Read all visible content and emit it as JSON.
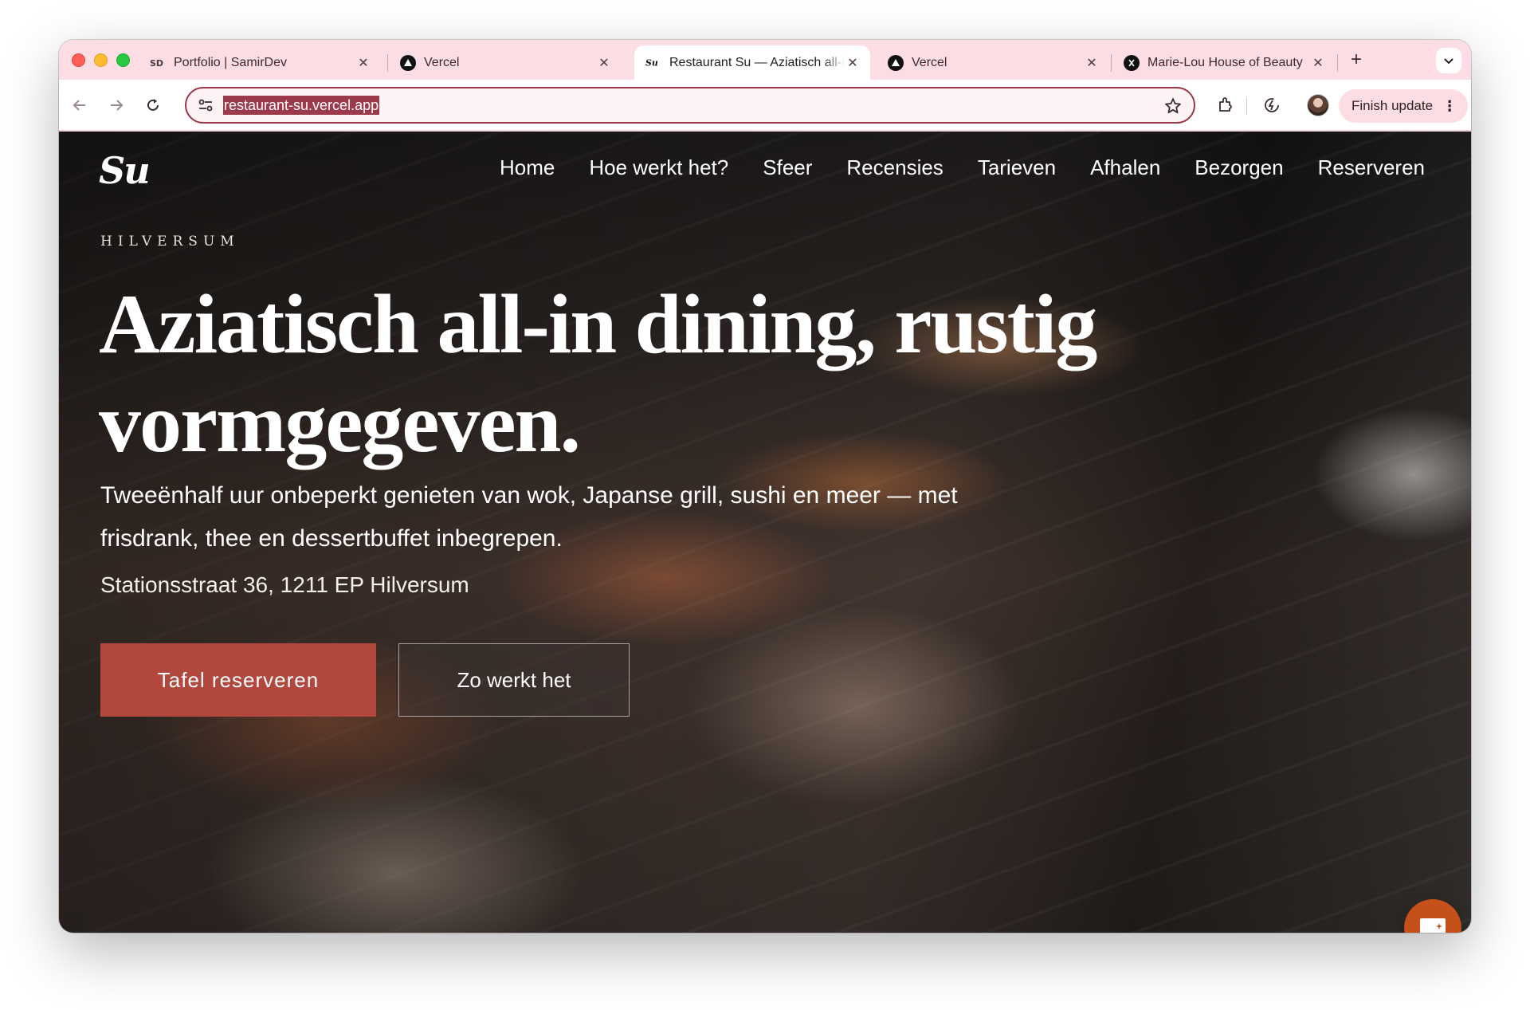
{
  "browser": {
    "tabs": [
      {
        "title": "Portfolio | SamirDev",
        "favicon": "sd-logo-icon",
        "active": false
      },
      {
        "title": "Vercel",
        "favicon": "vercel-icon",
        "active": false
      },
      {
        "title": "Restaurant Su — Aziatisch all-in dining",
        "favicon": "su-logo-icon",
        "active": true
      },
      {
        "title": "Vercel",
        "favicon": "vercel-icon",
        "active": false
      },
      {
        "title": "Marie-Lou House of Beauty",
        "favicon": "marie-lou-icon",
        "active": false
      }
    ],
    "tab_close_glyph": "✕",
    "new_tab_glyph": "+",
    "url": "restaurant-su.vercel.app",
    "finish_update_label": "Finish update",
    "menu_glyph": "⋮",
    "accent_color": "#9b3a4b",
    "frame_color": "#fbdde3"
  },
  "site": {
    "logo_text": "Su",
    "nav": [
      "Home",
      "Hoe werkt het?",
      "Sfeer",
      "Recensies",
      "Tarieven",
      "Afhalen",
      "Bezorgen",
      "Reserveren"
    ],
    "eyebrow": "HILVERSUM",
    "headline": "Aziatisch all-in dining, rustig vormgegeven.",
    "lead": "Tweeënhalf uur onbeperkt genieten van wok, Japanse grill, sushi en meer — met frisdrank, thee en dessertbuffet inbegrepen.",
    "address": "Stationsstraat 36, 1211 EP Hilversum",
    "primary_cta": "Tafel reserveren",
    "secondary_cta": "Zo werkt het",
    "primary_color": "#b2473d",
    "chat_button_color": "#c4501a",
    "chat_icon": "chat-bubble-icon",
    "hero_image": "sushi-buffet-photo"
  }
}
